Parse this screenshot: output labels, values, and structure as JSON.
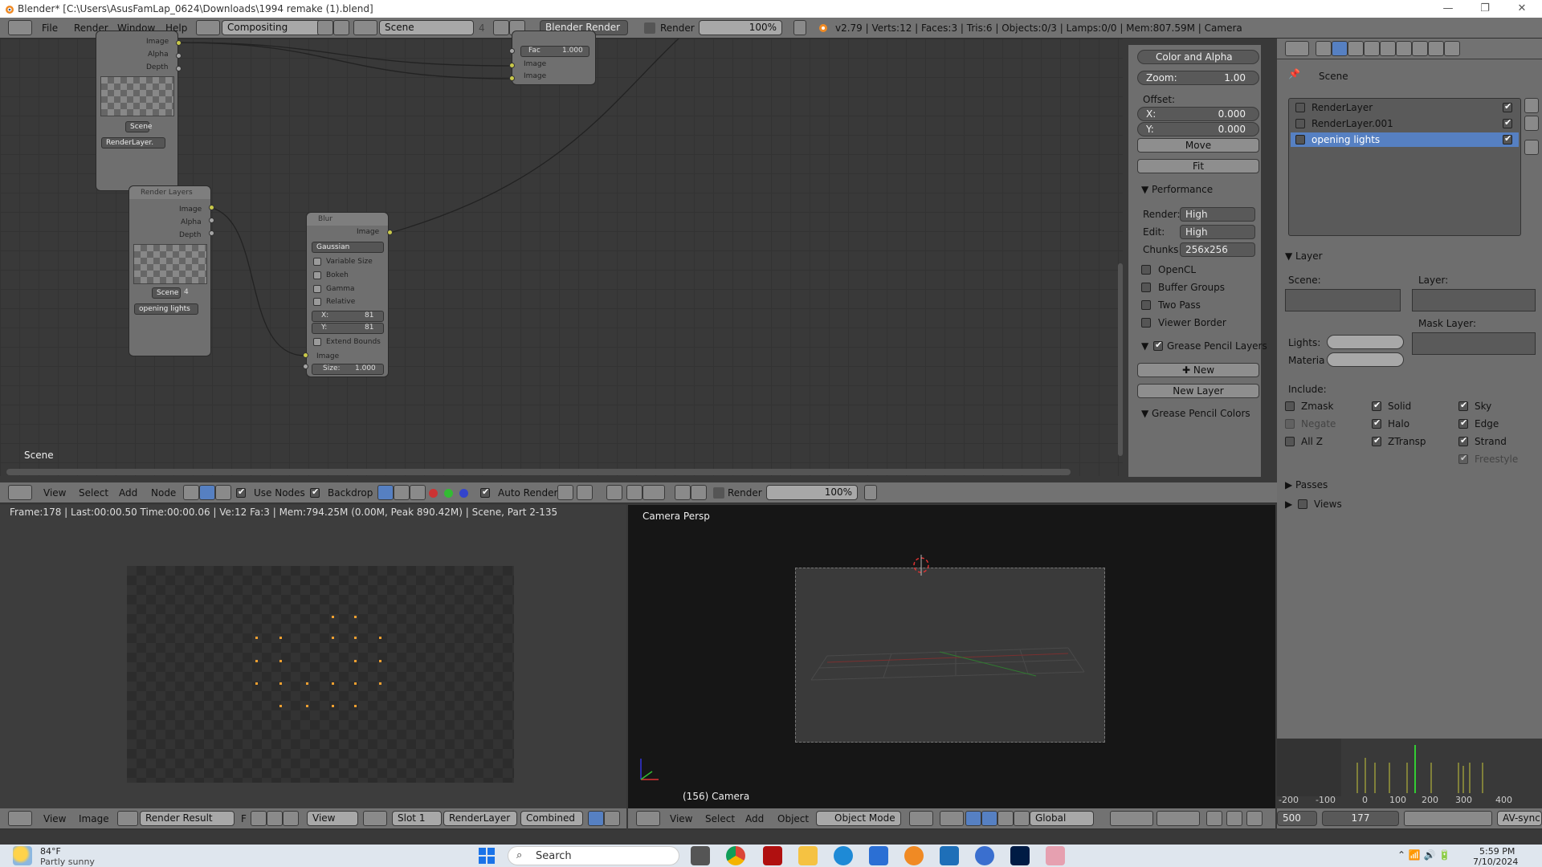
{
  "window": {
    "title": "Blender* [C:\\Users\\AsusFamLap_0624\\Downloads\\1994 remake (1).blend]",
    "controls": [
      "—",
      "❐",
      "✕"
    ]
  },
  "topbar": {
    "menus": [
      "File",
      "Render",
      "Window",
      "Help"
    ],
    "screen_layout": "Compositing",
    "scene": "Scene",
    "scene_users": "4",
    "engine": "Blender Render",
    "render_label": "Render",
    "render_zoom": "100%",
    "stats": "v2.79 | Verts:12 | Faces:3 | Tris:6 | Objects:0/3 | Lamps:0/0 | Mem:807.59M | Camera"
  },
  "node_editor": {
    "corner_label": "Scene",
    "nodes": {
      "rl_top": {
        "outputs": [
          "Image",
          "Alpha",
          "Depth"
        ],
        "scene": "Scene",
        "layer": "RenderLayer."
      },
      "mix": {
        "fac_label": "Fac",
        "fac_value": "1.000",
        "inputs": [
          "Image",
          "Image"
        ]
      },
      "render_layers": {
        "title": "Render Layers",
        "outputs": [
          "Image",
          "Alpha",
          "Depth"
        ],
        "scene": "Scene",
        "scene_users": "4",
        "layer": "opening lights"
      },
      "blur": {
        "title": "Blur",
        "output": "Image",
        "filter": "Gaussian",
        "options": [
          "Variable Size",
          "Bokeh",
          "Gamma",
          "Relative"
        ],
        "x_label": "X:",
        "x": "81",
        "y_label": "Y:",
        "y": "81",
        "extend": "Extend Bounds",
        "input": "Image",
        "size_label": "Size:",
        "size": "1.000"
      }
    },
    "header": {
      "menus": [
        "View",
        "Select",
        "Add",
        "Node"
      ],
      "use_nodes": "Use Nodes",
      "backdrop": "Backdrop",
      "auto_render": "Auto Render",
      "render_label": "Render",
      "zoom": "100%"
    }
  },
  "sidebar": {
    "mode": "Color and Alpha",
    "zoom_label": "Zoom:",
    "zoom": "1.00",
    "offset_label": "Offset:",
    "x_label": "X:",
    "x": "0.000",
    "y_label": "Y:",
    "y": "0.000",
    "move": "Move",
    "fit": "Fit",
    "performance": "Performance",
    "render_label": "Render:",
    "render": "High",
    "edit_label": "Edit:",
    "edit": "High",
    "chunks_label": "Chunks",
    "chunks": "256x256",
    "checks": [
      "OpenCL",
      "Buffer Groups",
      "Two Pass",
      "Viewer Border"
    ],
    "gp_layers": "Grease Pencil Layers",
    "new": "New",
    "new_layer": "New Layer",
    "gp_colors": "Grease Pencil Colors"
  },
  "image_editor": {
    "info": "Frame:178 | Last:00:00.50 Time:00:00.06 | Ve:12 Fa:3 | Mem:794.25M (0.00M, Peak 890.42M) | Scene, Part 2-135",
    "header": {
      "menus": [
        "View",
        "Image"
      ],
      "image": "Render Result",
      "f": "F",
      "view": "View",
      "slot": "Slot 1",
      "layer": "RenderLayer",
      "pass": "Combined"
    }
  },
  "viewport": {
    "label": "Camera Persp",
    "object": "(156) Camera",
    "header": {
      "menus": [
        "View",
        "Select",
        "Add",
        "Object"
      ],
      "mode": "Object Mode",
      "orientation": "Global"
    }
  },
  "properties": {
    "scene": "Scene",
    "layers": [
      {
        "name": "RenderLayer",
        "selected": false
      },
      {
        "name": "RenderLayer.001",
        "selected": false
      },
      {
        "name": "opening lights",
        "selected": true
      }
    ],
    "layer_section": "Layer",
    "scene_label": "Scene:",
    "layer_label": "Layer:",
    "mask_label": "Mask Layer:",
    "lights_label": "Lights:",
    "material_label": "Materia",
    "include_label": "Include:",
    "include": [
      {
        "name": "Zmask",
        "on": false
      },
      {
        "name": "Solid",
        "on": true
      },
      {
        "name": "Sky",
        "on": true
      },
      {
        "name": "Negate",
        "on": false
      },
      {
        "name": "Halo",
        "on": true
      },
      {
        "name": "Edge",
        "on": true
      },
      {
        "name": "All Z",
        "on": false
      },
      {
        "name": "ZTransp",
        "on": true
      },
      {
        "name": "Strand",
        "on": true
      },
      {
        "name": "Freestyle",
        "on": true
      }
    ],
    "passes": "Passes",
    "views": "Views"
  },
  "timeline": {
    "ticks": [
      "-200",
      "-100",
      "0",
      "100",
      "200",
      "300",
      "400"
    ],
    "start": "500",
    "current": "177",
    "sync": "AV-sync"
  },
  "taskbar": {
    "temp": "84°F",
    "weather": "Partly sunny",
    "search": "Search",
    "time": "5:59 PM",
    "date": "7/10/2024"
  },
  "colors": {
    "accent": "#5680c2",
    "socket": "#c8c84a",
    "orange": "#f0a030"
  }
}
